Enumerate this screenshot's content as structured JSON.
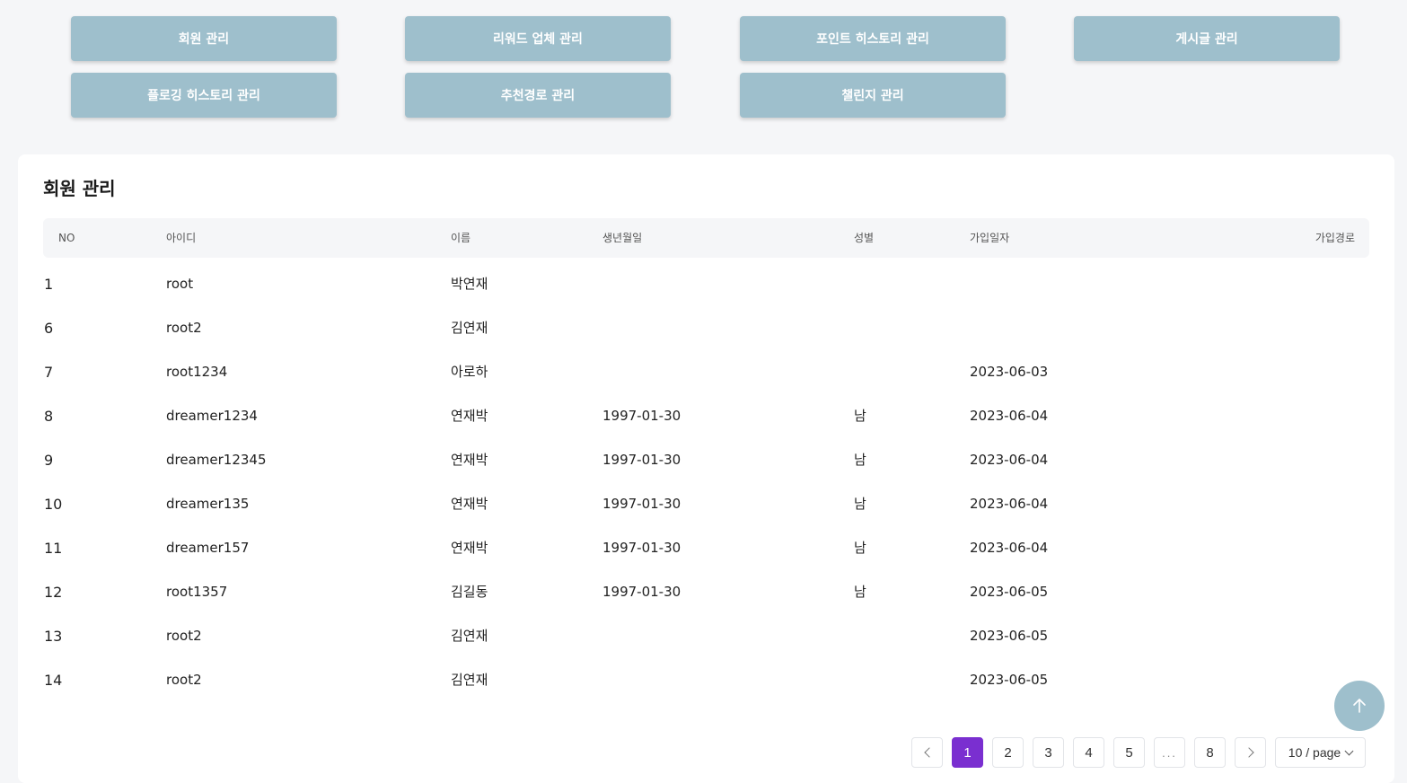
{
  "nav": {
    "buttons": [
      "회원 관리",
      "리워드 업체 관리",
      "포인트 히스토리 관리",
      "게시글 관리",
      "플로깅 히스토리 관리",
      "추천경로 관리",
      "챌린지 관리"
    ]
  },
  "card": {
    "title": "회원 관리"
  },
  "table": {
    "headers": [
      "NO",
      "아이디",
      "이름",
      "생년월일",
      "성별",
      "가입일자",
      "가입경로"
    ],
    "rows": [
      [
        "1",
        "root",
        "박연재",
        "",
        "",
        "",
        ""
      ],
      [
        "6",
        "root2",
        "김연재",
        "",
        "",
        "",
        ""
      ],
      [
        "7",
        "root1234",
        "아로하",
        "",
        "",
        "2023-06-03",
        ""
      ],
      [
        "8",
        "dreamer1234",
        "연재박",
        "1997-01-30",
        "남",
        "2023-06-04",
        ""
      ],
      [
        "9",
        "dreamer12345",
        "연재박",
        "1997-01-30",
        "남",
        "2023-06-04",
        ""
      ],
      [
        "10",
        "dreamer135",
        "연재박",
        "1997-01-30",
        "남",
        "2023-06-04",
        ""
      ],
      [
        "11",
        "dreamer157",
        "연재박",
        "1997-01-30",
        "남",
        "2023-06-04",
        ""
      ],
      [
        "12",
        "root1357",
        "김길동",
        "1997-01-30",
        "남",
        "2023-06-05",
        ""
      ],
      [
        "13",
        "root2",
        "김연재",
        "",
        "",
        "2023-06-05",
        ""
      ],
      [
        "14",
        "root2",
        "김연재",
        "",
        "",
        "2023-06-05",
        ""
      ]
    ]
  },
  "pagination": {
    "pages": [
      "1",
      "2",
      "3",
      "4",
      "5"
    ],
    "ellipsis": "...",
    "last_page": "8",
    "current_page": "1",
    "page_size": "10 / page"
  },
  "icons": {
    "prev": "chevron-left-icon",
    "next": "chevron-right-icon",
    "page_size_dropdown": "chevron-down-icon",
    "scroll_top": "arrow-up-icon"
  },
  "colors": {
    "nav_button_bg": "#9ebfcc",
    "active_page": "#7a2fd0",
    "page_bg": "#f5f6f8"
  }
}
